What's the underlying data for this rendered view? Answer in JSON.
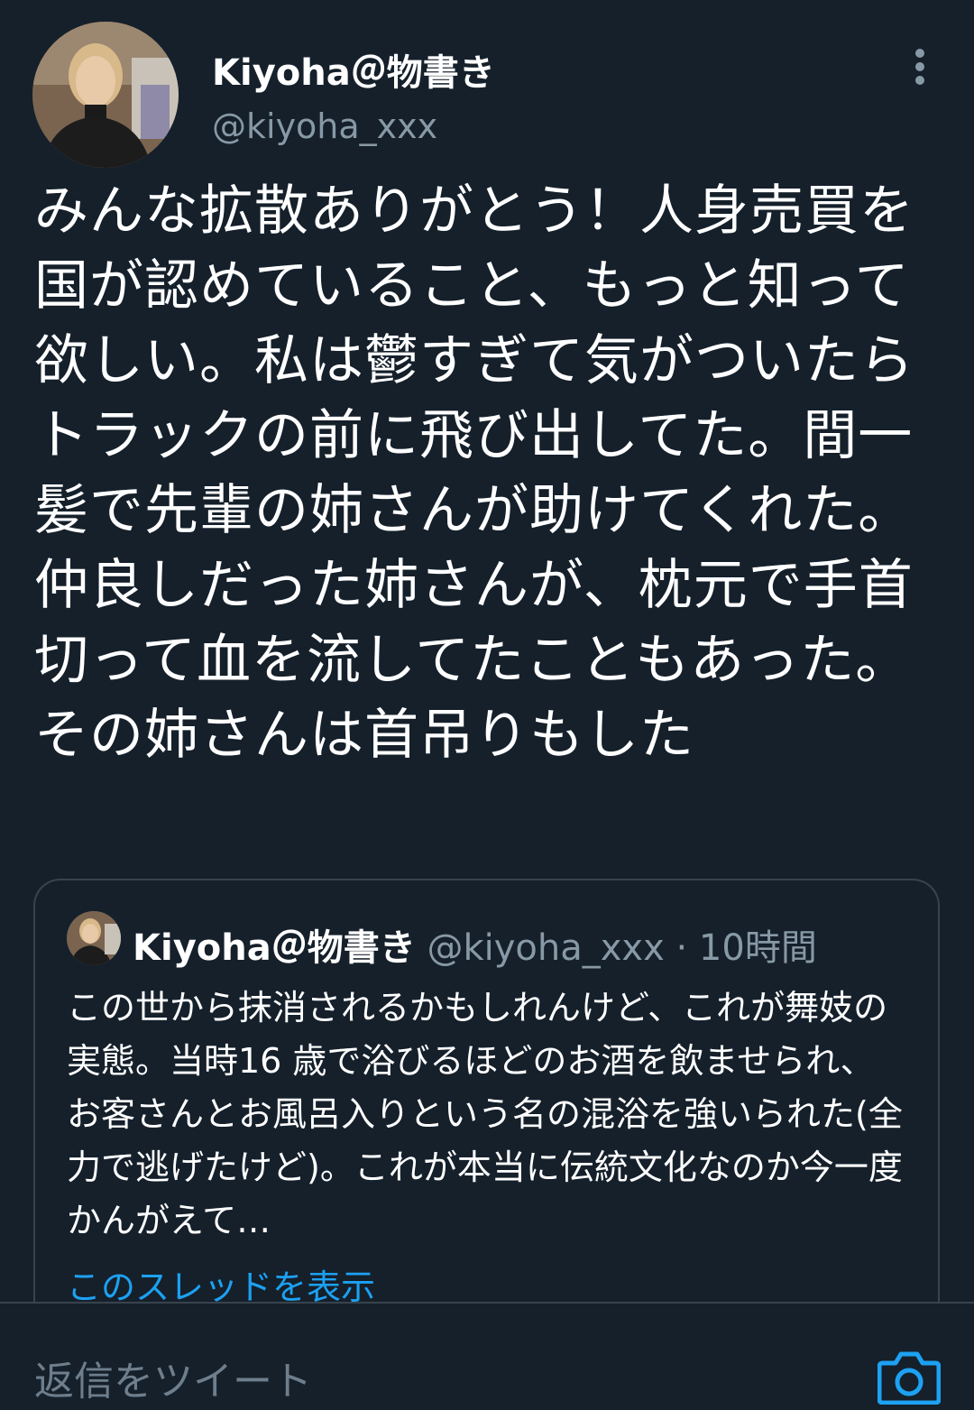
{
  "author": {
    "display_name": "Kiyoha＠物書き",
    "handle": "@kiyoha_xxx"
  },
  "icons": {
    "more": "more-vertical-icon",
    "camera": "camera-icon"
  },
  "tweet": {
    "text": "みんな拡散ありがとう！人身売買を国が認めていること、もっと知って欲しい。私は鬱すぎて気がついたらトラックの前に飛び出してた。間一髪で先輩の姉さんが助けてくれた。仲良しだった姉さんが、枕元で手首切って血を流してたこともあった。その姉さんは首吊りもした"
  },
  "quote": {
    "display_name": "Kiyoha＠物書き",
    "handle": "@kiyoha_xxx",
    "separator": "·",
    "time": "10時間",
    "text": "この世から抹消されるかもしれんけど、これが舞妓の実態。当時16 歳で浴びるほどのお酒を飲ませられ、お客さんとお風呂入りという名の混浴を強いられた(全力で逃げたけど)。これが本当に伝統文化なのか今一度かんがえて…",
    "show_thread_label": "このスレッドを表示"
  },
  "reply": {
    "placeholder": "返信をツイート"
  },
  "colors": {
    "background": "#15202b",
    "text_primary": "#ffffff",
    "text_secondary": "#8899a6",
    "border": "#38444d",
    "accent": "#1da1f2"
  }
}
